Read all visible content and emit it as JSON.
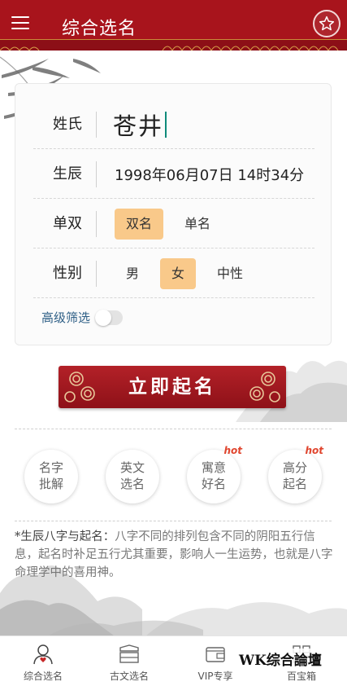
{
  "header": {
    "title": "综合选名",
    "menu_icon": "hamburger-menu-icon",
    "favorite_icon": "star-icon",
    "background_color": "#a8141c"
  },
  "form": {
    "surname": {
      "label": "姓氏",
      "value": "苍井"
    },
    "birth": {
      "label": "生辰",
      "value": "1998年06月07日 14时34分"
    },
    "name_length": {
      "label": "单双",
      "options": [
        "双名",
        "单名"
      ],
      "selected": "双名"
    },
    "gender": {
      "label": "性别",
      "options": [
        "男",
        "女",
        "中性"
      ],
      "selected": "女"
    },
    "advanced": {
      "label": "高级筛选",
      "enabled": false
    }
  },
  "cta": {
    "label": "立即起名",
    "color": "#a8141c"
  },
  "features": [
    {
      "label": "名字\n批解",
      "hot": ""
    },
    {
      "label": "英文\n选名",
      "hot": ""
    },
    {
      "label": "寓意\n好名",
      "hot": "hot"
    },
    {
      "label": "高分\n起名",
      "hot": "hot"
    }
  ],
  "info": {
    "title": "*生辰八字与起名：",
    "body": "八字不同的排列包含不同的阴阳五行信息，起名时补足五行尤其重要，影响人一生运势，也就是八字命理学中的喜用神。"
  },
  "bottom_nav": [
    {
      "label": "综合选名",
      "icon": "person-heart-icon",
      "active": true
    },
    {
      "label": "古文选名",
      "icon": "ancient-book-icon",
      "active": false
    },
    {
      "label": "VIP专享",
      "icon": "vip-wallet-icon",
      "active": false
    },
    {
      "label": "百宝箱",
      "icon": "grid-icon",
      "active": false
    }
  ],
  "colors": {
    "accent": "#a8141c",
    "chip_active": "#f9c98a",
    "link": "#2e5f86"
  }
}
